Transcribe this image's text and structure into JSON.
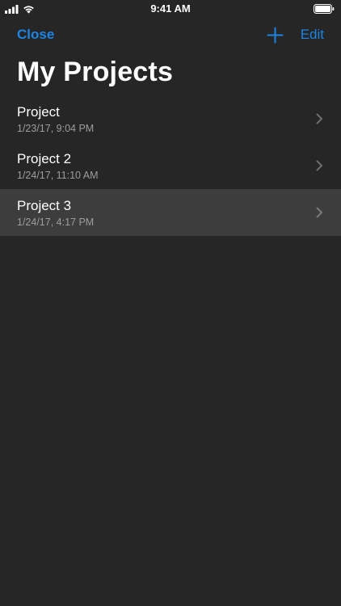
{
  "status_bar": {
    "time": "9:41 AM",
    "signal_icon": "cellular-signal-icon",
    "wifi_icon": "wifi-icon",
    "battery_icon": "battery-icon"
  },
  "nav": {
    "close_label": "Close",
    "add_icon": "plus-icon",
    "edit_label": "Edit"
  },
  "title": "My Projects",
  "projects": [
    {
      "name": "Project",
      "date": "1/23/17, 9:04 PM",
      "selected": false
    },
    {
      "name": "Project 2",
      "date": "1/24/17, 11:10 AM",
      "selected": false
    },
    {
      "name": "Project 3",
      "date": "1/24/17, 4:17 PM",
      "selected": true
    }
  ],
  "colors": {
    "background": "#262626",
    "accent": "#1b84e4",
    "selected_row": "#3d3d3d",
    "secondary_text": "#9d9d9d"
  }
}
